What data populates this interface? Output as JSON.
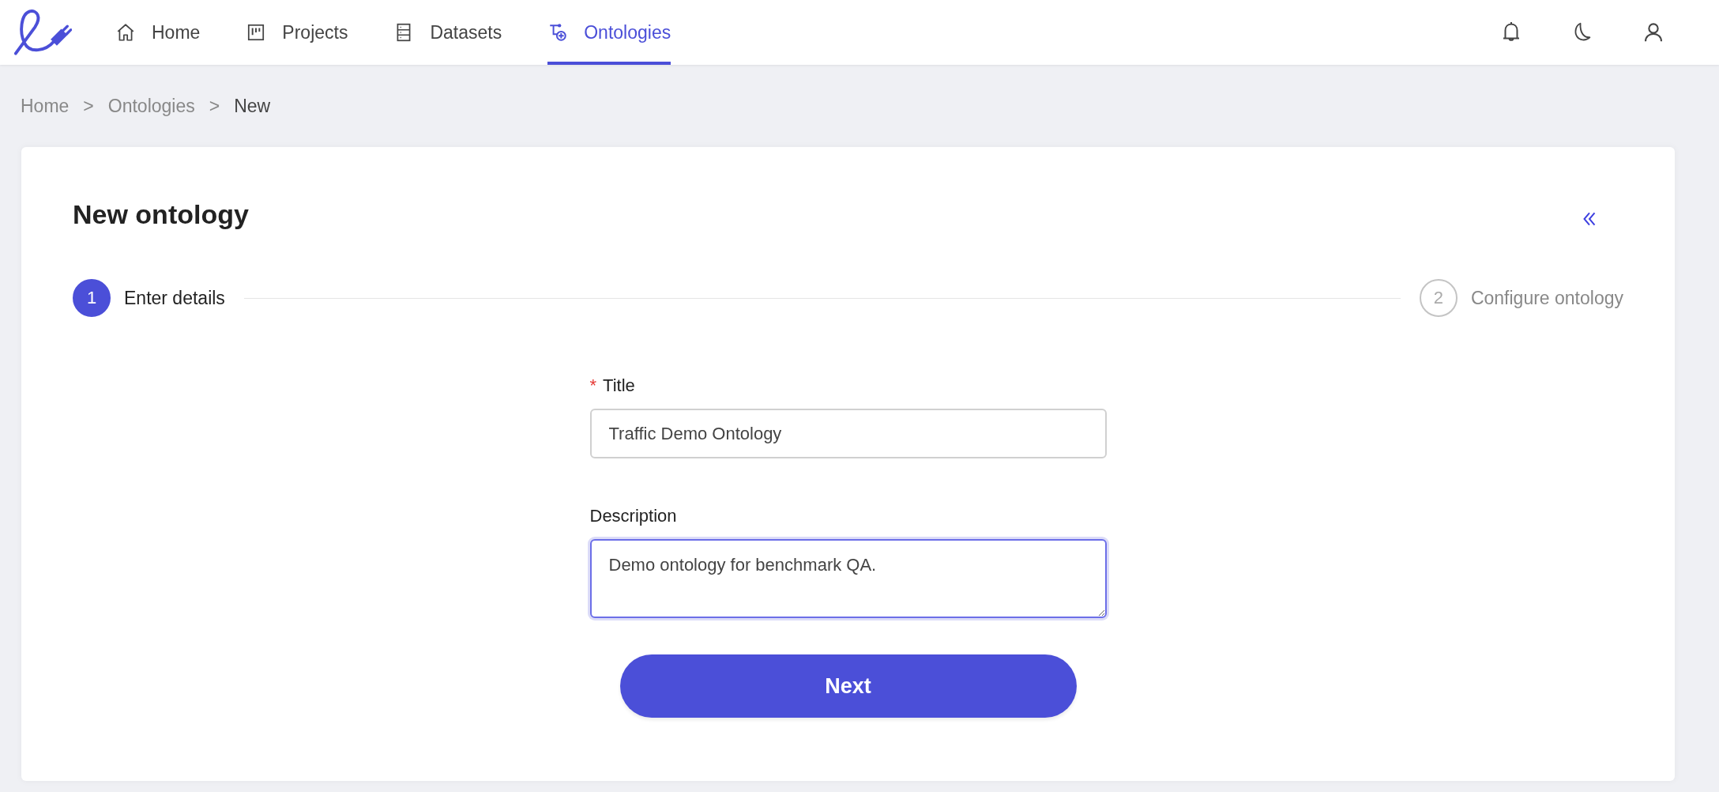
{
  "nav": {
    "items": [
      {
        "label": "Home",
        "selected": false
      },
      {
        "label": "Projects",
        "selected": false
      },
      {
        "label": "Datasets",
        "selected": false
      },
      {
        "label": "Ontologies",
        "selected": true
      }
    ]
  },
  "breadcrumb": [
    {
      "label": "Home",
      "current": false
    },
    {
      "label": "Ontologies",
      "current": false
    },
    {
      "label": "New",
      "current": true
    }
  ],
  "breadcrumb_separator": ">",
  "page": {
    "title": "New ontology",
    "steps": [
      {
        "number": "1",
        "label": "Enter details",
        "selected": true
      },
      {
        "number": "2",
        "label": "Configure ontology",
        "selected": false
      }
    ],
    "fields": [
      {
        "kind": "input",
        "label": "Title",
        "required": true,
        "value": "Traffic Demo Ontology",
        "focused": false
      },
      {
        "kind": "textarea",
        "label": "Description",
        "required": false,
        "value": "Demo ontology for benchmark QA.",
        "focused": true
      }
    ],
    "required_mark": "*",
    "button": "Next"
  }
}
